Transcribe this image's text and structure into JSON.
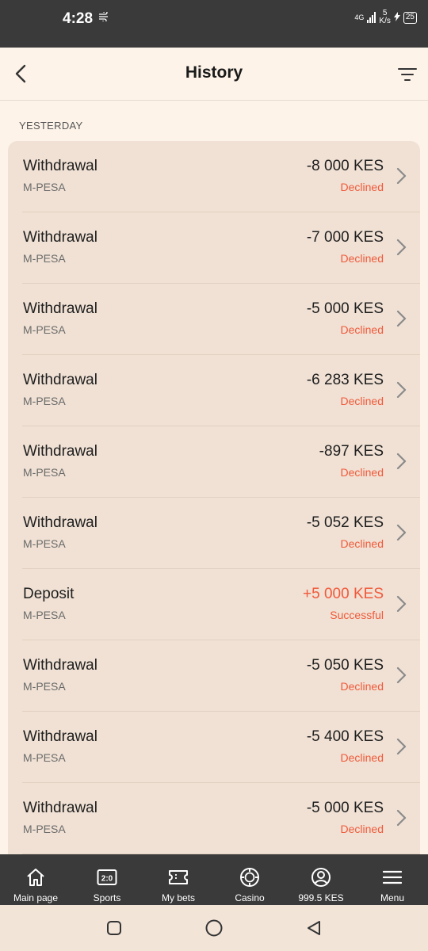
{
  "status_bar": {
    "time": "4:28",
    "net_type": "4G",
    "speed_value": "5",
    "speed_unit": "K/s",
    "battery": "25"
  },
  "header": {
    "title": "History"
  },
  "section": {
    "label": "YESTERDAY"
  },
  "transactions": [
    {
      "title": "Withdrawal",
      "method": "M-PESA",
      "amount": "-8 000 KES",
      "status": "Declined"
    },
    {
      "title": "Withdrawal",
      "method": "M-PESA",
      "amount": "-7 000 KES",
      "status": "Declined"
    },
    {
      "title": "Withdrawal",
      "method": "M-PESA",
      "amount": "-5 000 KES",
      "status": "Declined"
    },
    {
      "title": "Withdrawal",
      "method": "M-PESA",
      "amount": "-6 283 KES",
      "status": "Declined"
    },
    {
      "title": "Withdrawal",
      "method": "M-PESA",
      "amount": "-897 KES",
      "status": "Declined"
    },
    {
      "title": "Withdrawal",
      "method": "M-PESA",
      "amount": "-5 052 KES",
      "status": "Declined"
    },
    {
      "title": "Deposit",
      "method": "M-PESA",
      "amount": "+5 000 KES",
      "status": "Successful"
    },
    {
      "title": "Withdrawal",
      "method": "M-PESA",
      "amount": "-5 050 KES",
      "status": "Declined"
    },
    {
      "title": "Withdrawal",
      "method": "M-PESA",
      "amount": "-5 400 KES",
      "status": "Declined"
    },
    {
      "title": "Withdrawal",
      "method": "M-PESA",
      "amount": "-5 000 KES",
      "status": "Declined"
    }
  ],
  "bottom_nav": {
    "main": "Main page",
    "sports": "Sports",
    "sports_glyph": "2:0",
    "bets": "My bets",
    "casino": "Casino",
    "balance": "999.5 KES",
    "menu": "Menu"
  },
  "colors": {
    "accent": "#f1593a",
    "dark_bar": "#3a3a3a",
    "page_bg": "#fdf3e9",
    "card_bg": "#f0e1d4"
  },
  "icons": {
    "back": "chevron-left-icon",
    "filter": "filter-icon",
    "row": "chevron-right-icon",
    "home": "home-icon",
    "sports": "scoreboard-icon",
    "bets": "ticket-icon",
    "casino": "chip-icon",
    "account": "user-icon",
    "menu": "hamburger-icon"
  }
}
